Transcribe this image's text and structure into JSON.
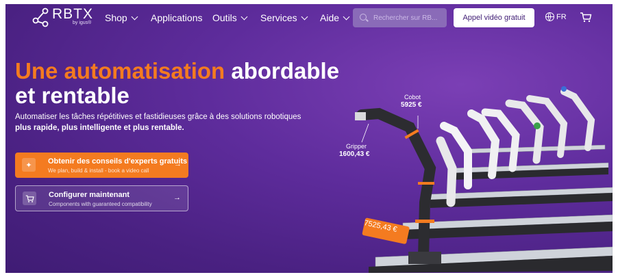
{
  "nav": {
    "logo": "RBTX",
    "logo_sub": "by igus®",
    "items": [
      {
        "label": "Shop",
        "dropdown": true
      },
      {
        "label": "Applications",
        "dropdown": false
      },
      {
        "label": "Outils",
        "dropdown": true
      },
      {
        "label": "Services",
        "dropdown": true
      },
      {
        "label": "Aide",
        "dropdown": true
      }
    ],
    "search_placeholder": "Rechercher sur RB...",
    "cta": "Appel vidéo gratuit",
    "language": "FR",
    "icons": {
      "logo": "network-logo-icon",
      "search": "search-icon",
      "globe": "globe-icon",
      "cart": "cart-icon"
    }
  },
  "hero": {
    "headline_highlight": "Une automatisation",
    "headline_rest_1": "abordable",
    "headline_rest_2": "et rentable",
    "subline": "Automatiser les tâches répétitives et fastidieuses grâce à des solutions robotiques",
    "subline_bold": "plus rapide, plus intelligente et plus rentable.",
    "buttons": [
      {
        "title": "Obtenir des conseils d'experts gratuits",
        "subtitle": "We plan, build & install - book a video call",
        "icon": "expert-icon"
      },
      {
        "title": "Configurer maintenant",
        "subtitle": "Components with guaranteed compatibility",
        "icon": "cart-icon"
      }
    ],
    "arrow": "→"
  },
  "price_tags": {
    "cobot": {
      "label": "Cobot",
      "price": "5925 €"
    },
    "gripper": {
      "label": "Gripper",
      "price": "1600,43 €"
    },
    "total": {
      "price": "7525,43 €"
    }
  },
  "colors": {
    "brand_orange": "#f47b20",
    "background_purple": "#5e2c9c"
  }
}
